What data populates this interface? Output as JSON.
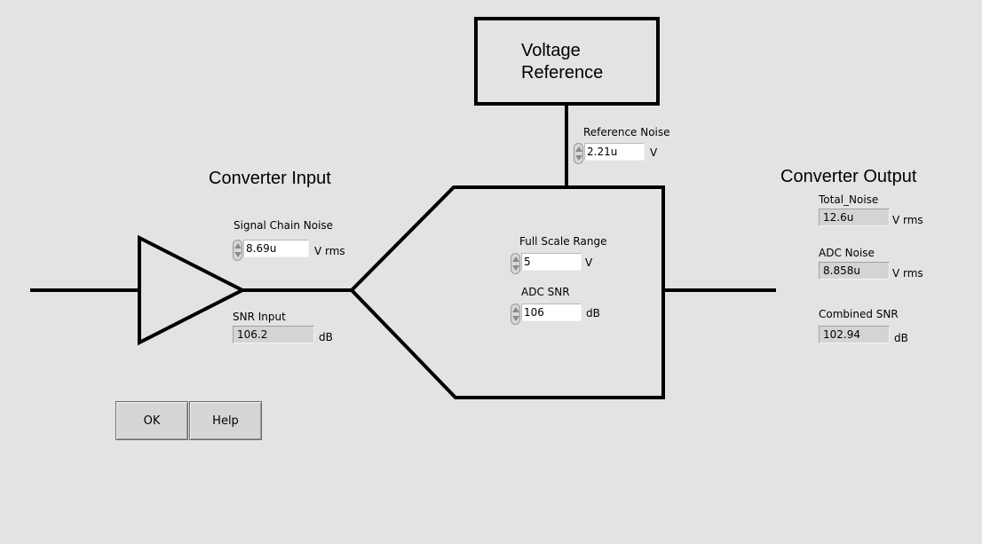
{
  "voltage_reference": {
    "title_line1": "Voltage",
    "title_line2": "Reference"
  },
  "converter_input": {
    "heading": "Converter Input",
    "signal_chain_noise": {
      "label": "Signal Chain Noise",
      "value": "8.69u",
      "unit": "V rms"
    },
    "snr_input": {
      "label": "SNR Input",
      "value": "106.2",
      "unit": "dB"
    }
  },
  "reference_noise": {
    "label": "Reference Noise",
    "value": "2.21u",
    "unit": "V"
  },
  "adc": {
    "full_scale_range": {
      "label": "Full Scale Range",
      "value": "5",
      "unit": "V"
    },
    "adc_snr": {
      "label": "ADC SNR",
      "value": "106",
      "unit": "dB"
    }
  },
  "converter_output": {
    "heading": "Converter Output",
    "total_noise": {
      "label": "Total_Noise",
      "value": "12.6u",
      "unit": "V rms"
    },
    "adc_noise": {
      "label": "ADC Noise",
      "value": "8.858u",
      "unit": "V rms"
    },
    "combined_snr": {
      "label": "Combined SNR",
      "value": "102.94",
      "unit": "dB"
    }
  },
  "buttons": {
    "ok": "OK",
    "help": "Help"
  }
}
